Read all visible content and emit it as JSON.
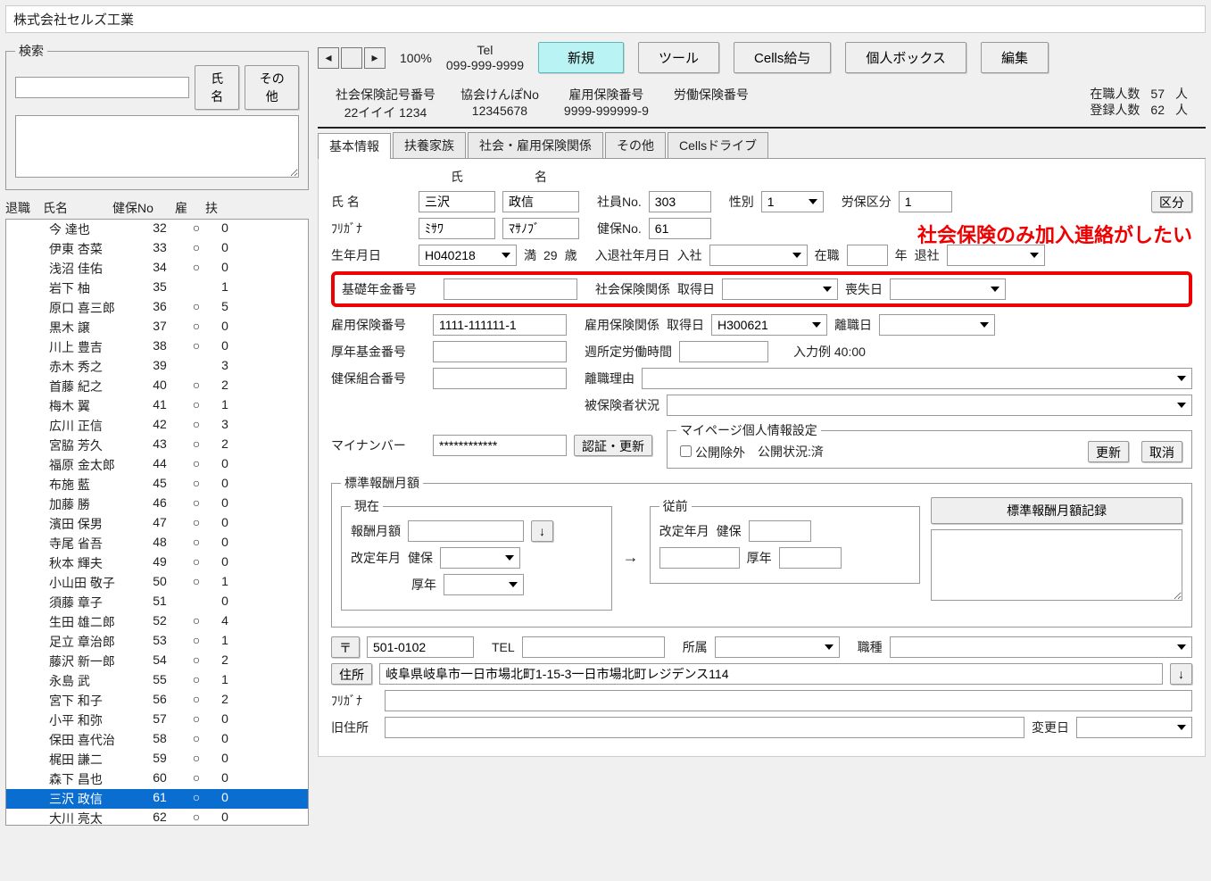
{
  "app_title": "株式会社セルズ工業",
  "search": {
    "legend": "検索",
    "btn_name": "氏名",
    "btn_other": "その他"
  },
  "emp_table_header": {
    "c1": "退職",
    "c2": "氏名",
    "c3": "健保No",
    "c4": "雇",
    "c5": "扶"
  },
  "employees": [
    {
      "name": "今 達也",
      "kenpo": "32",
      "ko": "○",
      "fu": "0"
    },
    {
      "name": "伊東 杏菜",
      "kenpo": "33",
      "ko": "○",
      "fu": "0"
    },
    {
      "name": "浅沼 佳佑",
      "kenpo": "34",
      "ko": "○",
      "fu": "0"
    },
    {
      "name": "岩下 柚",
      "kenpo": "35",
      "ko": "",
      "fu": "1"
    },
    {
      "name": "原口 喜三郎",
      "kenpo": "36",
      "ko": "○",
      "fu": "5"
    },
    {
      "name": "黒木 譲",
      "kenpo": "37",
      "ko": "○",
      "fu": "0"
    },
    {
      "name": "川上 豊吉",
      "kenpo": "38",
      "ko": "○",
      "fu": "0"
    },
    {
      "name": "赤木 秀之",
      "kenpo": "39",
      "ko": "",
      "fu": "3"
    },
    {
      "name": "首藤 紀之",
      "kenpo": "40",
      "ko": "○",
      "fu": "2"
    },
    {
      "name": "梅木 翼",
      "kenpo": "41",
      "ko": "○",
      "fu": "1"
    },
    {
      "name": "広川 正信",
      "kenpo": "42",
      "ko": "○",
      "fu": "3"
    },
    {
      "name": "宮脇 芳久",
      "kenpo": "43",
      "ko": "○",
      "fu": "2"
    },
    {
      "name": "福原 金太郎",
      "kenpo": "44",
      "ko": "○",
      "fu": "0"
    },
    {
      "name": "布施 藍",
      "kenpo": "45",
      "ko": "○",
      "fu": "0"
    },
    {
      "name": "加藤 勝",
      "kenpo": "46",
      "ko": "○",
      "fu": "0"
    },
    {
      "name": "濱田 保男",
      "kenpo": "47",
      "ko": "○",
      "fu": "0"
    },
    {
      "name": "寺尾 省吾",
      "kenpo": "48",
      "ko": "○",
      "fu": "0"
    },
    {
      "name": "秋本 輝夫",
      "kenpo": "49",
      "ko": "○",
      "fu": "0"
    },
    {
      "name": "小山田 敬子",
      "kenpo": "50",
      "ko": "○",
      "fu": "1"
    },
    {
      "name": "須藤 章子",
      "kenpo": "51",
      "ko": "",
      "fu": "0"
    },
    {
      "name": "生田 雄二郎",
      "kenpo": "52",
      "ko": "○",
      "fu": "4"
    },
    {
      "name": "足立 章治郎",
      "kenpo": "53",
      "ko": "○",
      "fu": "1"
    },
    {
      "name": "藤沢 新一郎",
      "kenpo": "54",
      "ko": "○",
      "fu": "2"
    },
    {
      "name": "永島 武",
      "kenpo": "55",
      "ko": "○",
      "fu": "1"
    },
    {
      "name": "宮下 和子",
      "kenpo": "56",
      "ko": "○",
      "fu": "2"
    },
    {
      "name": "小平 和弥",
      "kenpo": "57",
      "ko": "○",
      "fu": "0"
    },
    {
      "name": "保田 喜代治",
      "kenpo": "58",
      "ko": "○",
      "fu": "0"
    },
    {
      "name": "梶田 謙二",
      "kenpo": "59",
      "ko": "○",
      "fu": "0"
    },
    {
      "name": "森下 昌也",
      "kenpo": "60",
      "ko": "○",
      "fu": "0"
    },
    {
      "name": "三沢 政信",
      "kenpo": "61",
      "ko": "○",
      "fu": "0",
      "selected": true
    },
    {
      "name": "大川 亮太",
      "kenpo": "62",
      "ko": "○",
      "fu": "0"
    }
  ],
  "toolbar": {
    "zoom": "100%",
    "tel_label": "Tel",
    "tel": "099-999-9999",
    "btn_new": "新規",
    "btn_tool": "ツール",
    "btn_cells": "Cells給与",
    "btn_box": "個人ボックス",
    "btn_edit": "編集"
  },
  "summary": {
    "c1_lbl": "社会保険記号番号",
    "c1_val": "22イイイ 1234",
    "c2_lbl": "協会けんぽNo",
    "c2_val": "12345678",
    "c3_lbl": "雇用保険番号",
    "c3_val": "9999-999999-9",
    "c4_lbl": "労働保険番号",
    "c4_val": "",
    "r1_lbl": "在職人数",
    "r1_val": "57",
    "r_unit": "人",
    "r2_lbl": "登録人数",
    "r2_val": "62"
  },
  "tabs": [
    "基本情報",
    "扶養家族",
    "社会・雇用保険関係",
    "その他",
    "Cellsドライブ"
  ],
  "form": {
    "sei_hdr": "氏",
    "mei_hdr": "名",
    "lbl_name": "氏 名",
    "sei": "三沢",
    "mei": "政信",
    "lbl_furigana": "ﾌﾘｶﾞﾅ",
    "sei_kana": "ﾐｻﾜ",
    "mei_kana": "ﾏｻﾉﾌﾞ",
    "lbl_empno": "社員No.",
    "empno": "303",
    "lbl_kenpono": "健保No.",
    "kenpono": "61",
    "lbl_sex": "性別",
    "sex": "1",
    "lbl_rouho": "労保区分",
    "rouho": "1",
    "btn_kubun": "区分",
    "lbl_birth": "生年月日",
    "birth": "H040218",
    "age_man": "満",
    "age": "29",
    "age_sai": "歳",
    "lbl_hire": "入退社年月日",
    "hire_lbl": "入社",
    "zai_lbl": "在職",
    "year_lbl": "年",
    "retire_lbl": "退社",
    "lbl_kiso": "基礎年金番号",
    "lbl_shakai": "社会保険関係",
    "lbl_shutoku": "取得日",
    "lbl_soushitsu": "喪失日",
    "lbl_koyo_no": "雇用保険番号",
    "koyo_no": "1111-111111-1",
    "lbl_koyo_rel": "雇用保険関係",
    "koyo_shutoku": "H300621",
    "lbl_rishoku": "離職日",
    "lbl_konen": "厚年基金番号",
    "lbl_shu_hours": "週所定労働時間",
    "example": "入力例 40:00",
    "lbl_kenpo_kumiai": "健保組合番号",
    "lbl_rishoku_riyu": "離職理由",
    "lbl_hihokensha": "被保険者状況",
    "lbl_myno": "マイナンバー",
    "myno": "************",
    "btn_ninsho": "認証・更新",
    "mypage_legend": "マイページ個人情報設定",
    "lbl_koukai_jogai": "公開除外",
    "lbl_koukai_status": "公開状況:済",
    "btn_update": "更新",
    "btn_cancel": "取消",
    "std_legend": "標準報酬月額",
    "cur_legend": "現在",
    "prev_legend": "従前",
    "lbl_houshugaku": "報酬月額",
    "lbl_kaitei": "改定年月",
    "lbl_kenpo_s": "健保",
    "lbl_kounen_s": "厚年",
    "btn_kiroku": "標準報酬月額記録",
    "btn_post": "〒",
    "post": "501-0102",
    "lbl_tel": "TEL",
    "lbl_shozoku": "所属",
    "lbl_shokushu": "職種",
    "btn_addr": "住所",
    "addr": "岐阜県岐阜市一日市場北町1‐15‐3一日市場北町レジデンス114",
    "lbl_addr_kana": "ﾌﾘｶﾞﾅ",
    "lbl_old_addr": "旧住所",
    "lbl_henko": "変更日",
    "arrow_down": "↓",
    "arrow_right": "→"
  },
  "annotation": "社会保険のみ加入連絡がしたい"
}
